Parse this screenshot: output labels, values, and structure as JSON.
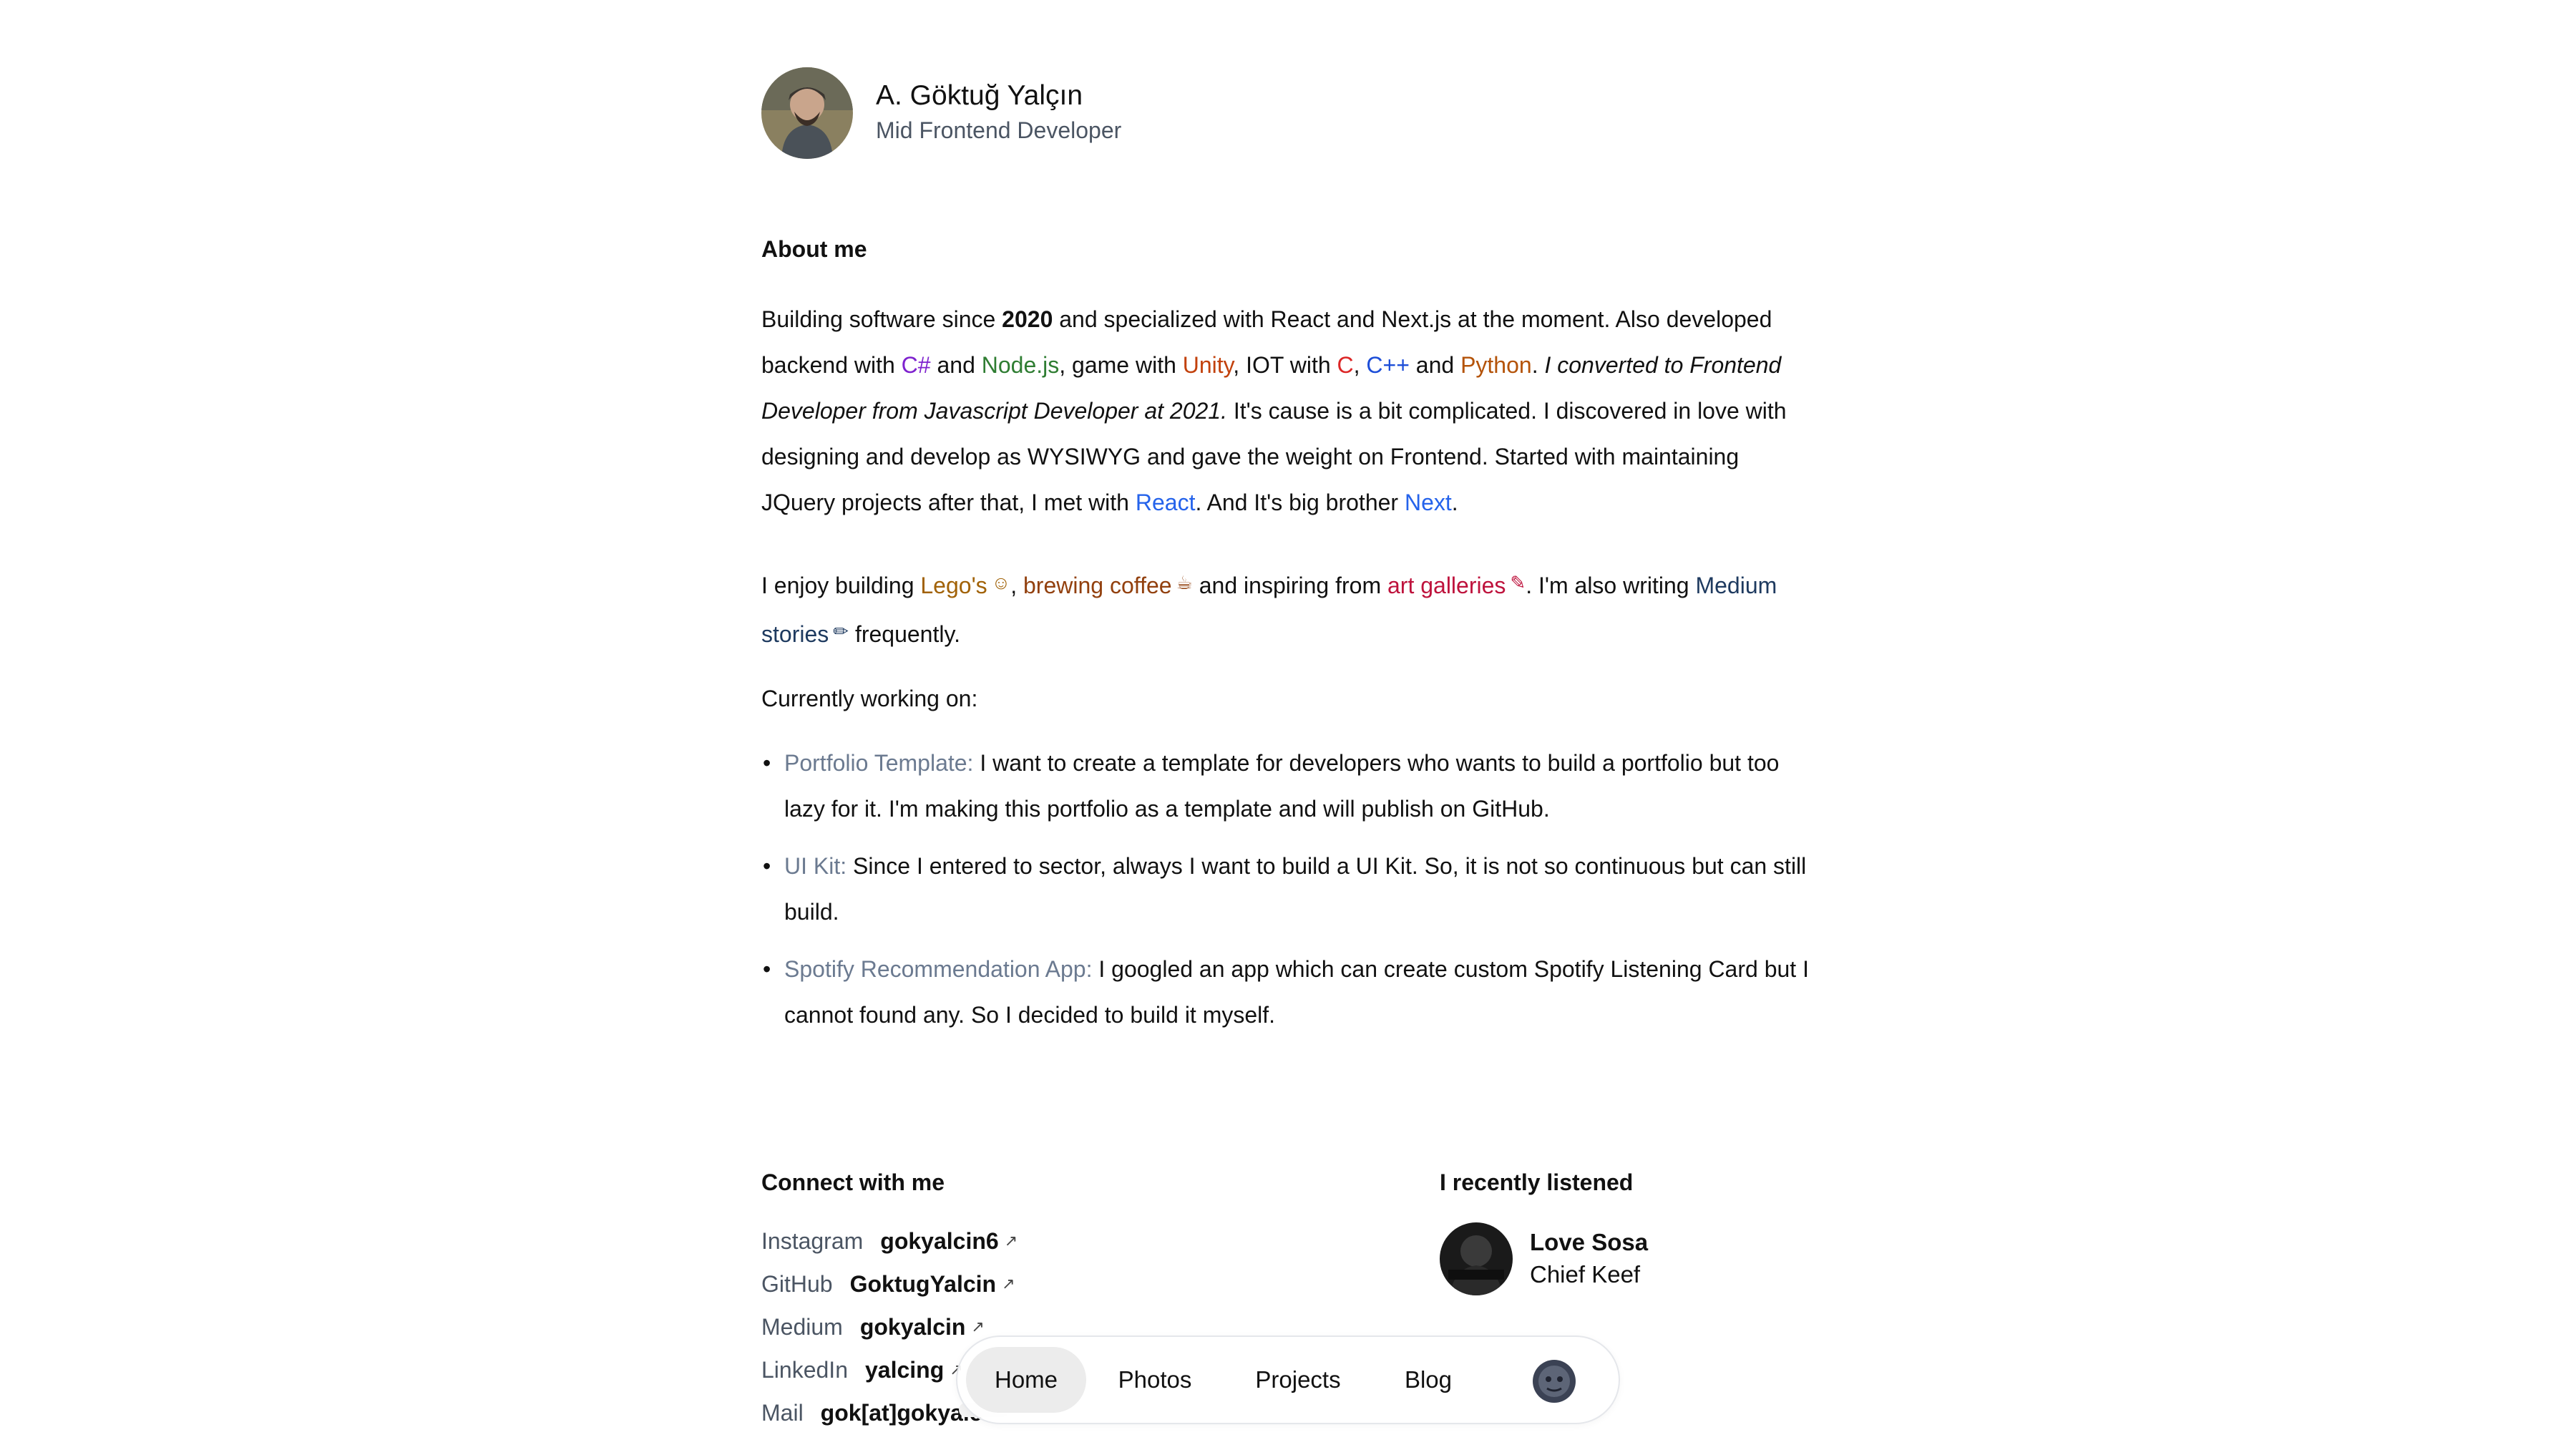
{
  "profile": {
    "name": "A. Göktuğ Yalçın",
    "role": "Mid Frontend Developer"
  },
  "about": {
    "heading": "About me",
    "p1": {
      "t1": "Building software since ",
      "year": "2020",
      "t2": " and specialized with React and Next.js at the moment. Also developed backend with ",
      "csharp": "C#",
      "t3": " and ",
      "nodejs": "Node.js",
      "t4": ", game with ",
      "unity": "Unity",
      "t5": ", IOT with ",
      "c": "C",
      "t6": ", ",
      "cpp": "C++",
      "t7": " and ",
      "python": "Python",
      "t8": ". ",
      "italic": "I converted to Frontend Developer from Javascript Developer at 2021.",
      "t9": " It's cause is a bit complicated. I discovered in love with designing and develop as WYSIWYG and gave the weight on Frontend. Started with maintaining JQuery projects after that, I met with ",
      "react": "React",
      "t10": ". And It's big brother ",
      "next": "Next",
      "t11": "."
    },
    "p2": {
      "t1": "I enjoy building ",
      "lego": "Lego's",
      "t2": ", ",
      "coffee": "brewing coffee",
      "t3": " and inspiring from ",
      "art": "art galleries",
      "t4": ". I'm also writing ",
      "medium": "Medium stories",
      "t5": " frequently."
    }
  },
  "working": {
    "heading": "Currently working on:",
    "items": [
      {
        "title": "Portfolio Template:",
        "text": " I want to create a template for developers who wants to build a portfolio but too lazy for it. I'm making this portfolio as a template and will publish on GitHub."
      },
      {
        "title": "UI Kit:",
        "text": " Since I entered to sector, always I want to build a UI Kit. So, it is not so continuous but can still build."
      },
      {
        "title": "Spotify Recommendation App:",
        "text": " I googled an app which can create custom Spotify Listening Card but I cannot found any. So I decided to build it myself."
      }
    ]
  },
  "connect": {
    "heading": "Connect with me",
    "links": [
      {
        "name": "Instagram",
        "handle": "gokyalcin6"
      },
      {
        "name": "GitHub",
        "handle": "GoktugYalcin"
      },
      {
        "name": "Medium",
        "handle": "gokyalcin"
      },
      {
        "name": "LinkedIn",
        "handle": "yalcing"
      },
      {
        "name": "Mail",
        "handle": "gok[at]gokyalc"
      }
    ],
    "arrow_glyph": "↗"
  },
  "listened": {
    "heading": "I recently listened",
    "title": "Love Sosa",
    "artist": "Chief Keef"
  },
  "nav": {
    "items": [
      "Home",
      "Photos",
      "Projects",
      "Blog"
    ],
    "active": "Home"
  },
  "icons": {
    "lego": "lego-smiley-icon",
    "coffee": "coffee-cup-icon",
    "art": "paintbrush-icon",
    "medium": "pencil-icon",
    "external": "external-arrow-icon"
  },
  "colors": {
    "csharp": "#7e22ce",
    "nodejs": "#2f7d32",
    "unity": "#c2410c",
    "c": "#dc2626",
    "cpp": "#1d4ed8",
    "python": "#b45309",
    "link": "#2563eb"
  }
}
